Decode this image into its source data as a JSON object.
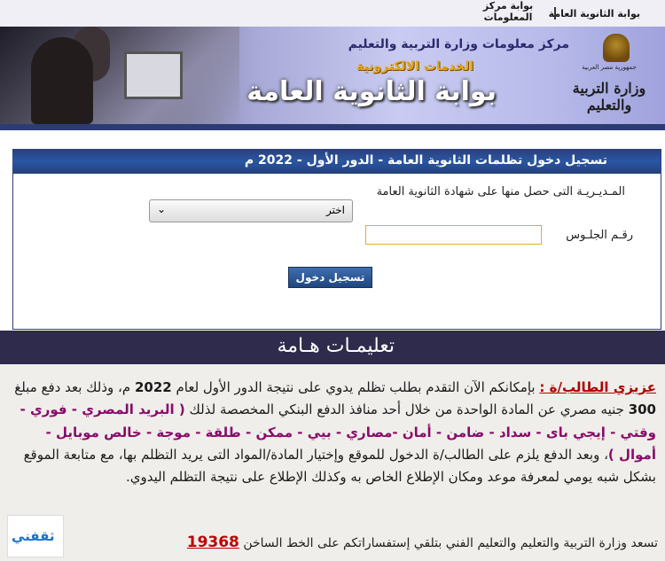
{
  "topbar": {
    "link_portal": "بوابة الثانوية العامة",
    "link_info_center_line1": "بوابة مركز",
    "link_info_center_line2": "المعلومات"
  },
  "banner": {
    "center_name": "مركز معلومات وزارة التربية والتعليم",
    "eservices": "الخدمات الالكترونية",
    "portal_title": "بوابة الثانوية العامة",
    "ministry_caption": "جمهورية مصر العربية",
    "ministry_logo": "وزارة التربية والتعليم"
  },
  "login": {
    "heading": "تسجيل دخول تظلمات الثانوية العامة - الدور الأول - 2022 م",
    "directorate_label": "المـديـريـة التى حصل منها على شهادة الثانوية العامة",
    "directorate_value": "اختر",
    "seat_label": "رقـم الجلـوس",
    "submit": "تسجيل دخول"
  },
  "instructions": {
    "heading": "تعليمـات هـامة",
    "dear": "عزيزي الطالب/ة :",
    "text1": " بإمكانكم الآن التقدم بطلب تظلم يدوي على نتيجة الدور الأول لعام ",
    "year": "2022",
    "text2": " م، وذلك بعد دفع مبلغ ",
    "amount": "300",
    "text3": " جنيه مصري عن المادة الواحدة من خلال أحد منافذ الدفع البنكي المخصصة لذلك ",
    "providers": "( البريد المصري - فوري - وقتي - إيجي باى - سداد - ضامن - أمان -مصاري - بيي - ممكن - طلقة - موجة - خالص موبايل - أموال )",
    "text4": "، وبعد الدفع يلزم على الطالب/ة الدخول للموقع وإختيار المادة/المواد التى يريد التظلم بها، مع متابعة الموقع بشكل شبه يومي لمعرفة موعد ومكان الإطلاع الخاص به وكذلك الإطلاع على نتيجة التظلم اليدوي.",
    "hotline_text": "تسعد وزارة التربية والتعليم والتعليم الفني بتلقي إستفساراتكم على الخط الساخن ",
    "hotline_number": "19368",
    "badge": "ثقفني"
  },
  "colors": {
    "header_navy": "#2c3c72",
    "instructions_bar": "#2e2b4d",
    "hotline": "#c00000",
    "highlight": "#b30000",
    "providers": "#8b0a6a"
  }
}
